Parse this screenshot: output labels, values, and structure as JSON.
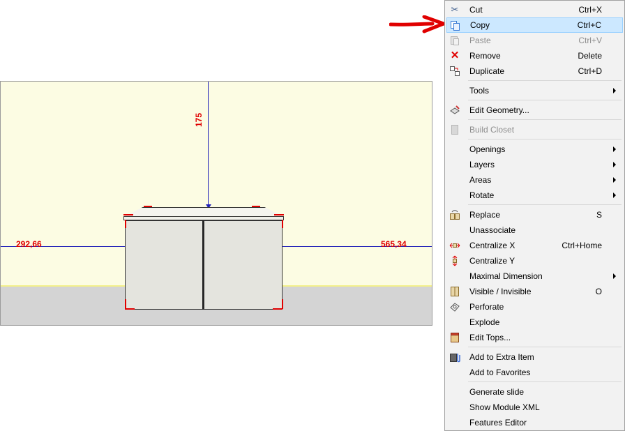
{
  "viewport": {
    "dimension_top": "175",
    "dimension_left": "292,66",
    "dimension_right": "565,34"
  },
  "menu": {
    "cut": {
      "label": "Cut",
      "shortcut": "Ctrl+X",
      "icon": "scissors-icon"
    },
    "copy": {
      "label": "Copy",
      "shortcut": "Ctrl+C",
      "icon": "copy-icon"
    },
    "paste": {
      "label": "Paste",
      "shortcut": "Ctrl+V",
      "icon": "paste-icon"
    },
    "remove": {
      "label": "Remove",
      "shortcut": "Delete",
      "icon": "remove-x-icon"
    },
    "duplicate": {
      "label": "Duplicate",
      "shortcut": "Ctrl+D",
      "icon": "duplicate-icon"
    },
    "tools": {
      "label": "Tools"
    },
    "edit_geometry": {
      "label": "Edit Geometry...",
      "icon": "edit-geometry-icon"
    },
    "build_closet": {
      "label": "Build Closet",
      "icon": "closet-icon"
    },
    "openings": {
      "label": "Openings"
    },
    "layers": {
      "label": "Layers"
    },
    "areas": {
      "label": "Areas"
    },
    "rotate": {
      "label": "Rotate"
    },
    "replace": {
      "label": "Replace",
      "shortcut": "S",
      "icon": "replace-icon"
    },
    "unassociate": {
      "label": "Unassociate"
    },
    "centralize_x": {
      "label": "Centralize X",
      "shortcut": "Ctrl+Home",
      "icon": "centralize-x-icon"
    },
    "centralize_y": {
      "label": "Centralize Y",
      "icon": "centralize-y-icon"
    },
    "maximal_dimension": {
      "label": "Maximal Dimension"
    },
    "visible_invisible": {
      "label": "Visible / Invisible",
      "shortcut": "O",
      "icon": "visibility-icon"
    },
    "perforate": {
      "label": "Perforate",
      "icon": "perforate-icon"
    },
    "explode": {
      "label": "Explode"
    },
    "edit_tops": {
      "label": "Edit Tops...",
      "icon": "edit-tops-icon"
    },
    "add_extra_item": {
      "label": "Add to Extra Item",
      "icon": "extra-item-icon"
    },
    "add_favorites": {
      "label": "Add to Favorites"
    },
    "generate_slide": {
      "label": "Generate slide"
    },
    "show_module_xml": {
      "label": "Show Module XML"
    },
    "features_editor": {
      "label": "Features Editor"
    }
  },
  "colors": {
    "highlight": "#cce8ff",
    "dimension_text": "#e00000",
    "dimension_line": "#1f1fb8",
    "annotation_arrow": "#e00000"
  }
}
